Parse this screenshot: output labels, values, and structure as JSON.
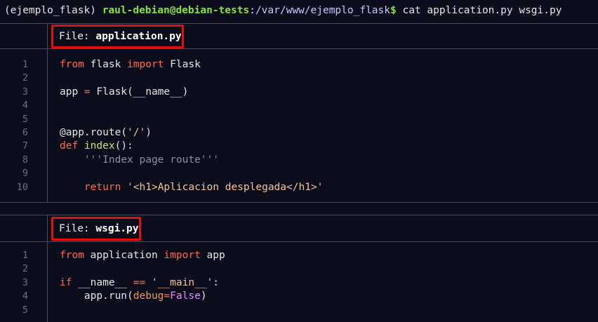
{
  "terminal": {
    "env": "(ejemplo_flask) ",
    "user_host": "raul-debian@debian-tests",
    "colon": ":",
    "path": "/var/www/ejemplo_flask",
    "symbol": "$ ",
    "command": "cat application.py wsgi.py"
  },
  "files": [
    {
      "label": "File: ",
      "name": "application.py",
      "lines": [
        {
          "num": "1",
          "tokens": [
            [
              "kw",
              "from"
            ],
            [
              "plain",
              " flask "
            ],
            [
              "kw",
              "import"
            ],
            [
              "plain",
              " Flask"
            ]
          ]
        },
        {
          "num": "2",
          "tokens": []
        },
        {
          "num": "3",
          "tokens": [
            [
              "plain",
              "app "
            ],
            [
              "kw",
              "="
            ],
            [
              "plain",
              " Flask(__name__)"
            ]
          ]
        },
        {
          "num": "4",
          "tokens": []
        },
        {
          "num": "5",
          "tokens": []
        },
        {
          "num": "6",
          "tokens": [
            [
              "plain",
              "@app.route("
            ],
            [
              "str",
              "'/'"
            ],
            [
              "plain",
              ")"
            ]
          ]
        },
        {
          "num": "7",
          "tokens": [
            [
              "kw",
              "def"
            ],
            [
              "plain",
              " "
            ],
            [
              "fn",
              "index"
            ],
            [
              "plain",
              "():"
            ]
          ]
        },
        {
          "num": "8",
          "tokens": [
            [
              "plain",
              "    "
            ],
            [
              "doc",
              "'''Index page route'''"
            ]
          ]
        },
        {
          "num": "9",
          "tokens": []
        },
        {
          "num": "10",
          "tokens": [
            [
              "plain",
              "    "
            ],
            [
              "kw",
              "return"
            ],
            [
              "plain",
              " "
            ],
            [
              "str",
              "'<h1>Aplicacion desplegada</h1>'"
            ]
          ]
        }
      ]
    },
    {
      "label": "File: ",
      "name": "wsgi.py",
      "lines": [
        {
          "num": "1",
          "tokens": [
            [
              "kw",
              "from"
            ],
            [
              "plain",
              " application "
            ],
            [
              "kw",
              "import"
            ],
            [
              "plain",
              " app"
            ]
          ]
        },
        {
          "num": "2",
          "tokens": []
        },
        {
          "num": "3",
          "tokens": [
            [
              "kw",
              "if"
            ],
            [
              "plain",
              " __name__ "
            ],
            [
              "kw",
              "=="
            ],
            [
              "plain",
              " "
            ],
            [
              "str",
              "'__main__'"
            ],
            [
              "plain",
              ":"
            ]
          ]
        },
        {
          "num": "4",
          "tokens": [
            [
              "plain",
              "    app.run("
            ],
            [
              "arg",
              "debug"
            ],
            [
              "kw",
              "="
            ],
            [
              "bool",
              "False"
            ],
            [
              "plain",
              ")"
            ]
          ]
        },
        {
          "num": "5",
          "tokens": []
        }
      ]
    }
  ]
}
